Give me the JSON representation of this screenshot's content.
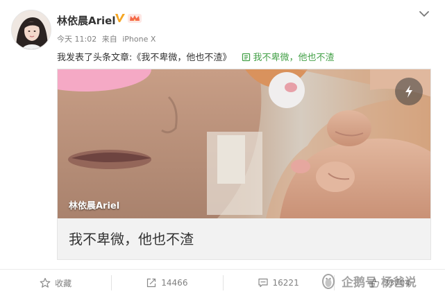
{
  "user": {
    "name": "林依晨Ariel",
    "avatar_icon": "avatar"
  },
  "meta": {
    "time": "今天 11:02",
    "source_prefix": "来自",
    "source": "iPhone X"
  },
  "post": {
    "text": "我发表了头条文章:《我不卑微，他也不渣》",
    "link_icon": "link-icon",
    "link_text": "我不卑微，他也不渣"
  },
  "card": {
    "author": "林依晨Ariel",
    "title": "我不卑微，他也不渣",
    "flash_icon": "lightning-icon"
  },
  "actions": [
    {
      "icon": "star-icon",
      "label": "收藏"
    },
    {
      "icon": "share-icon",
      "label": "14466"
    },
    {
      "icon": "comment-icon",
      "label": "16221"
    },
    {
      "icon": "like-icon",
      "label": "33704"
    }
  ],
  "watermark": {
    "text": "企鹅号 杨爸说"
  },
  "colors": {
    "link": "#43a047",
    "text": "#333333",
    "meta": "#808080",
    "card_bg": "#f2f2f2"
  }
}
